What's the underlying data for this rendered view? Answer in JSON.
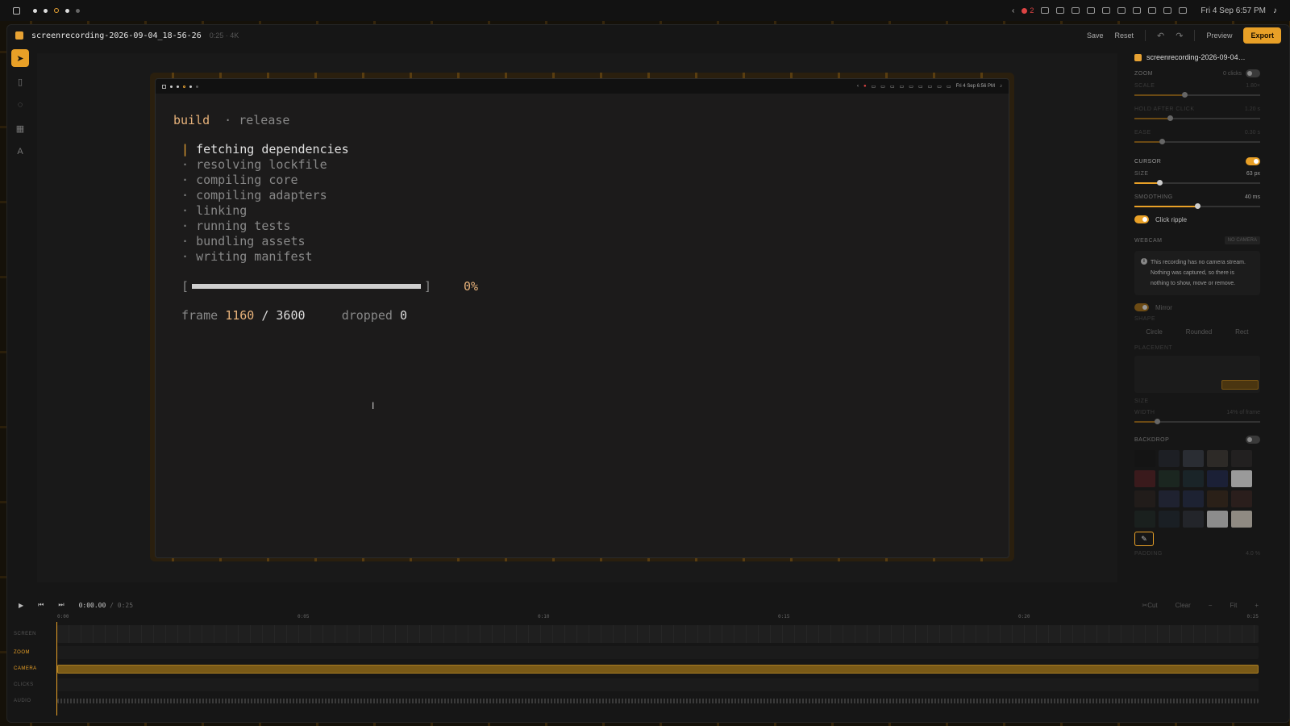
{
  "sysbar": {
    "notif_count": "2",
    "datetime": "Fri 4 Sep  6:57 PM"
  },
  "app": {
    "filename": "screenrecording-2026-09-04_18-56-26",
    "meta": "0:25 · 4K",
    "save_label": "Save",
    "reset_label": "Reset",
    "preview_label": "Preview",
    "export_label": "Export"
  },
  "tools": [
    "pointer-icon",
    "crop-icon",
    "hide-icon",
    "grid-icon",
    "text-icon"
  ],
  "inner_recording": {
    "datetime": "Fri 4 Sep  6:56 PM",
    "title_build": "build",
    "title_release": "· release",
    "current_marker": "|",
    "steps": [
      {
        "marker": "|",
        "text": "fetching dependencies"
      },
      {
        "marker": "·",
        "text": "resolving lockfile"
      },
      {
        "marker": "·",
        "text": "compiling core"
      },
      {
        "marker": "·",
        "text": "compiling adapters"
      },
      {
        "marker": "·",
        "text": "linking"
      },
      {
        "marker": "·",
        "text": "running tests"
      },
      {
        "marker": "·",
        "text": "bundling assets"
      },
      {
        "marker": "·",
        "text": "writing manifest"
      }
    ],
    "progress_open": "[",
    "progress_close": "]",
    "progress_value": 0,
    "progress_pct": "0%",
    "frame_label": "frame",
    "frame_current": "1160",
    "frame_sep": "/",
    "frame_total": "3600",
    "dropped_label": "dropped",
    "dropped_value": "0"
  },
  "panel": {
    "filename": "screenrecording-2026-09-04…",
    "zoom_label": "ZOOM",
    "zoom_clicks": "0 clicks",
    "scale_label": "SCALE",
    "scale_value": "1.80×",
    "scale_fraction": 0.4,
    "hold_label": "HOLD AFTER CLICK",
    "hold_value": "1.20 s",
    "hold_fraction": 0.28,
    "ease_label": "EASE",
    "ease_value": "0.30 s",
    "ease_fraction": 0.22,
    "cursor_label": "CURSOR",
    "size_label": "SIZE",
    "size_value": "63 px",
    "size_fraction": 0.2,
    "smoothing_label": "SMOOTHING",
    "smoothing_value": "40 ms",
    "smoothing_fraction": 0.5,
    "click_ripple_label": "Click ripple",
    "webcam_label": "WEBCAM",
    "webcam_badge": "NO CAMERA",
    "webcam_note": "This recording has no camera stream. Nothing was captured, so there is nothing to show, move or remove.",
    "mirror_label": "Mirror",
    "shape_label": "SHAPE",
    "shape_options": [
      "Circle",
      "Rounded",
      "Rect"
    ],
    "placement_label": "PLACEMENT",
    "size2_label": "SIZE",
    "width_label": "WIDTH",
    "width_value": "14% of frame",
    "width_fraction": 0.18,
    "backdrop_label": "BACKDROP",
    "padding_label": "PADDING",
    "padding_value": "4.0 %",
    "swatches": [
      "#141414",
      "#1d1f24",
      "#2a2d33",
      "#2d2a27",
      "#222020",
      "#3a1a1c",
      "#1b2620",
      "#1a2428",
      "#1b2036",
      "#9a9a9a",
      "#211c1a",
      "#1f2230",
      "#1d2232",
      "#2a2018",
      "#2a1e1c",
      "#1a201e",
      "#1a1f24",
      "#23252a",
      "#8c8c8c",
      "#8f8a82"
    ]
  },
  "timeline": {
    "time_current": "0:00.00",
    "time_sep": "/",
    "time_total": "0:25",
    "cut_label": "Cut",
    "clear_label": "Clear",
    "minus_label": "−",
    "fit_label": "Fit",
    "plus_label": "+",
    "ruler": [
      "0:00",
      "0:05",
      "0:10",
      "0:15",
      "0:20",
      "0:25"
    ],
    "tracks": [
      "SCREEN",
      "ZOOM",
      "CAMERA",
      "CLICKS",
      "AUDIO"
    ]
  }
}
